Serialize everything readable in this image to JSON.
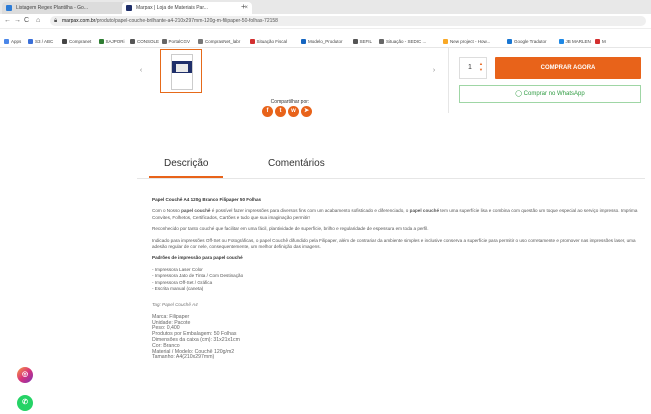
{
  "browser": {
    "tabs": [
      {
        "label": "Listagem Regex Plantilha - Go...",
        "color": "#2b7bd6"
      },
      {
        "label": "Marpax | Loja de Materiais Par...",
        "color": "#1f2f6a"
      }
    ],
    "new_tab": "+",
    "url_domain": "marpax.com.br",
    "url_path": "/produto/papel-couche-brilhante-a4-210x297mm-120g-m-filipaper-50-folhas-72158",
    "bookmarks": [
      {
        "label": "Apps",
        "color": "#4a86e8"
      },
      {
        "label": "S3 / ABC",
        "color": "#3a6fd8"
      },
      {
        "label": "Compranet",
        "color": "#444"
      },
      {
        "label": "SAJPORi",
        "color": "#2e7d32"
      },
      {
        "label": "CONSOLE",
        "color": "#555"
      },
      {
        "label": "PortalCGV",
        "color": "#666"
      },
      {
        "label": "ComprasNet_labr",
        "color": "#777"
      },
      {
        "label": "Situação Fiscal",
        "color": "#d32f2f"
      },
      {
        "label": "Modelo_Produtor",
        "color": "#1565c0"
      },
      {
        "label": "SEFIL",
        "color": "#555"
      },
      {
        "label": "Situação - SEDIC ...",
        "color": "#666"
      },
      {
        "label": "New project - How...",
        "color": "#f9a825"
      },
      {
        "label": "Google Tradutor",
        "color": "#1976d2"
      },
      {
        "label": "JB MARLEN",
        "color": "#1e88e5"
      },
      {
        "label": "M",
        "color": "#d32f2f"
      }
    ]
  },
  "product": {
    "quantity": "1",
    "buy_label": "COMPRAR AGORA",
    "whatsapp_label": "Comprar no WhatsApp",
    "share_label": "Compartilhar por:"
  },
  "tabs": {
    "description": "Descrição",
    "comments": "Comentários"
  },
  "description": {
    "title": "Papel Couchê A4 120g Branco Filipaper 50 Folhas",
    "p1_start": "Com o Nosso ",
    "p1_bold1": "papel couchê",
    "p1_mid": " é possível fazer impressões para diversos fins com um acabamento sofisticado e diferenciado, o ",
    "p1_bold2": "papel couché",
    "p1_end": " tem uma superfície lisa e combina com questão um toque especial ao serviço impresso. Imprima Convites, Folhetos, Certificados, Cartões e tudo que sua imaginação permitir!",
    "p2": "Reconhecido por tanto couché que facilitar em uma fácil, plantividade de superfície, brilho e regularidade de espessura em toda a perfil.",
    "p3": "Indicado para impressões Off-Set ou Fotográficas, o papel Couchê difundido pela Filipaper, além de contrariar da ambiente simples e inclusive conserva a superfície para permitir o uso corretamente e promover nas impressões laser, uma adesão regular de cor nele, consequentemente, um melhor definição das imagens.",
    "subheading": "Padrões de impressão para papel couché",
    "list": [
      "- Impressora Laser Color",
      "- Impressora Jato de Tinta / Com Destinação",
      "- Impressora Off-Set / Gráfica",
      "- Escrita manual (caneta)"
    ],
    "tag": "Tag: Papel Couchê A4",
    "specs": [
      "Marca: Filipaper",
      "Unidade: Pacote",
      "Peso: 0,400",
      "Produtos por Embalagem: 50 Folhas",
      "Dimensões da caixa (cm): 31x21x1cm",
      "Cor: Branco",
      "Material / Modelo: Couchê 120g/m2",
      "Tamanho: A4(210x297mm)"
    ]
  },
  "colors": {
    "accent": "#e8631a",
    "whatsapp": "#2e9b41"
  }
}
